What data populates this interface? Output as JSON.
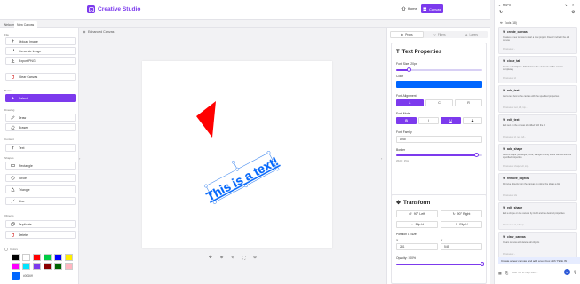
{
  "header": {
    "brand": "Creative Studio",
    "home_label": "Home",
    "canvas_label": "Canvas"
  },
  "tabs": [
    "Welcome",
    "New Canvas"
  ],
  "sidebar": {
    "file_section": "File",
    "upload": "Upload Image",
    "generate": "Generate Image",
    "export": "Export PNG",
    "clear": "Clear Canvas",
    "basic_section": "Basic",
    "select": "Select",
    "drawing_section": "Drawing",
    "draw": "Draw",
    "eraser": "Eraser",
    "content_section": "Content",
    "text": "Text",
    "shapes_section": "Shapes",
    "rectangle": "Rectangle",
    "circle": "Circle",
    "triangle": "Triangle",
    "line": "Line",
    "objects_section": "Objects",
    "duplicate": "Duplicate",
    "delete": "Delete",
    "colors_section": "Colors",
    "swatches": [
      "#000000",
      "#ffffff",
      "#ff0000",
      "#00cc44",
      "#0000ff",
      "#ffee00",
      "#ff00ff",
      "#00e5ff",
      "#7c3aed",
      "#8b0000",
      "#006400",
      "#ffb6c1"
    ],
    "current_color": "#0066ff",
    "current_hex": "#0066ff"
  },
  "canvas": {
    "title": "Enhanced Canvas",
    "text_object": "This is a text!",
    "text_color": "#0066ff",
    "triangle_color": "#ff0000"
  },
  "properties": {
    "tabs": [
      "Props",
      "Filters",
      "Layers"
    ],
    "text_props_title": "Text Properties",
    "font_size_label": "Font Size: 20px",
    "font_size_fraction": 0.15,
    "color_label": "Color",
    "color_value": "#0066ff",
    "align_label": "Font Alignment",
    "align_options": [
      "L",
      "C",
      "R"
    ],
    "mode_label": "Font Mode",
    "mode_options": [
      "B",
      "I",
      "U",
      "S"
    ],
    "family_label": "Font Family",
    "family_value": "Arial",
    "border_label": "Border",
    "border_fraction": 0.93,
    "border_sub": "Width: 15px",
    "transform_title": "Transform",
    "rotate_left": "90° Left",
    "rotate_right": "90° Right",
    "flip_h": "Flip H",
    "flip_v": "Flip V",
    "pos_label": "Position & Size",
    "x_label": "X",
    "y_label": "Y",
    "x_value": "281",
    "y_value": "545",
    "opacity_label": "Opacity: 100%",
    "opacity_fraction": 1.0
  },
  "agent": {
    "title": "RSPX",
    "tools_header": "Tools (18)",
    "tools": [
      {
        "name": "create_canvas",
        "desc": "Creates a new canvas to start a new project. Doesn't refresh the old canvas",
        "params": "Parameters: -"
      },
      {
        "name": "close_tab",
        "desc": "Create a detailpane. This deletes the elements on the canvas completely",
        "params": "Parameters: id"
      },
      {
        "name": "add_text",
        "desc": "Add a text box to the canvas with the specified properties",
        "params": "Parameters: text, left, top..."
      },
      {
        "name": "edit_text",
        "desc": "Edit text on the canvas identified with the id",
        "params": "Parameters: id, text, left..."
      },
      {
        "name": "add_shape",
        "desc": "Adds a shape (rectangle, circle, triangle or line) to the canvas with the specified properties",
        "params": "Parameters: shape, left, top..."
      },
      {
        "name": "remove_objects",
        "desc": "Remove objects from the canvas by giving the ids as a list",
        "params": "Parameters: ids"
      },
      {
        "name": "edit_shape",
        "desc": "Edit a shape on the canvas by its ID and the desired properties",
        "params": "Parameters: id, left, top..."
      },
      {
        "name": "clear_canvas",
        "desc": "Clears canvas and deletes all objects",
        "params": "Parameters: -"
      }
    ],
    "prompt": "Create a new canvas and add a text box with 'Hello W",
    "input_placeholder": "Ask me to help with..."
  }
}
